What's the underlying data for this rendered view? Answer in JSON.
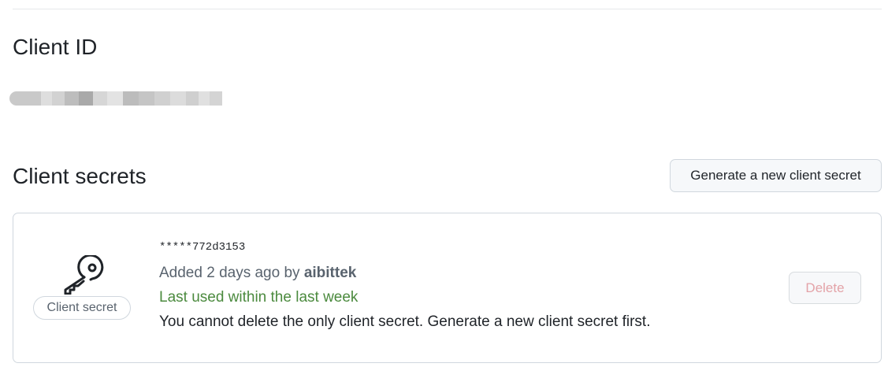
{
  "client_id": {
    "title": "Client ID"
  },
  "client_secrets": {
    "title": "Client secrets",
    "generate_button_label": "Generate a new client secret",
    "secret": {
      "badge_label": "Client secret",
      "icon": "key-icon",
      "masked_value": "*****772d3153",
      "added_prefix": "Added 2 days ago by ",
      "added_by": "aibittek",
      "last_used": "Last used within the last week",
      "warning": "You cannot delete the only client secret. Generate a new client secret first.",
      "delete_button_label": "Delete",
      "delete_disabled": true
    }
  },
  "colors": {
    "last_used_text": "#4b8a3e",
    "delete_disabled_text": "#e3a3a8",
    "border": "#d0d7de",
    "muted_text": "#59636e"
  }
}
